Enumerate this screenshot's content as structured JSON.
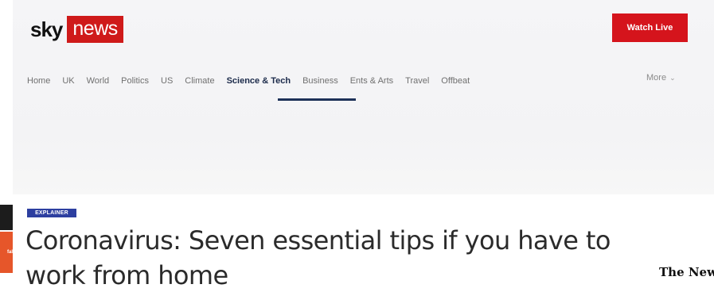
{
  "header": {
    "logo": {
      "sky": "sky",
      "news": "news"
    },
    "watch_live_label": "Watch Live",
    "nav": [
      {
        "label": "Home"
      },
      {
        "label": "UK"
      },
      {
        "label": "World"
      },
      {
        "label": "Politics"
      },
      {
        "label": "US"
      },
      {
        "label": "Climate"
      },
      {
        "label": "Science & Tech",
        "active": true
      },
      {
        "label": "Business"
      },
      {
        "label": "Ents & Arts"
      },
      {
        "label": "Travel"
      },
      {
        "label": "Offbeat"
      }
    ],
    "more_label": "More",
    "more_icon": "chevron-down-icon"
  },
  "article": {
    "badge": "EXPLAINER",
    "headline": "Coronavirus: Seven essential tips if you have to work from home"
  },
  "overlay": {
    "nyt_logo": "The New",
    "left_strip_text": "fal"
  },
  "colors": {
    "brand_red": "#cf1a1a",
    "watch_live_red": "#d5141c",
    "nav_active": "#1d3158",
    "badge_blue": "#2d3fa0"
  }
}
